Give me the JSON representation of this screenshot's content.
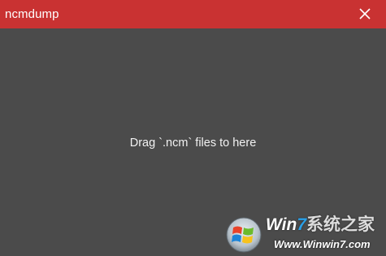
{
  "window": {
    "title": "ncmdump",
    "close_icon": "close-icon"
  },
  "content": {
    "drop_message": "Drag `.ncm` files to here"
  },
  "watermark": {
    "brand_win": "Wi",
    "brand_n": "n",
    "brand_seven": "7",
    "brand_rest": "系统之家",
    "url": "Www.Winwin7.com",
    "logo_icon": "windows-logo-icon"
  },
  "colors": {
    "titlebar": "#c93232",
    "background": "#4b4b4b",
    "text": "#f2f2f2"
  }
}
